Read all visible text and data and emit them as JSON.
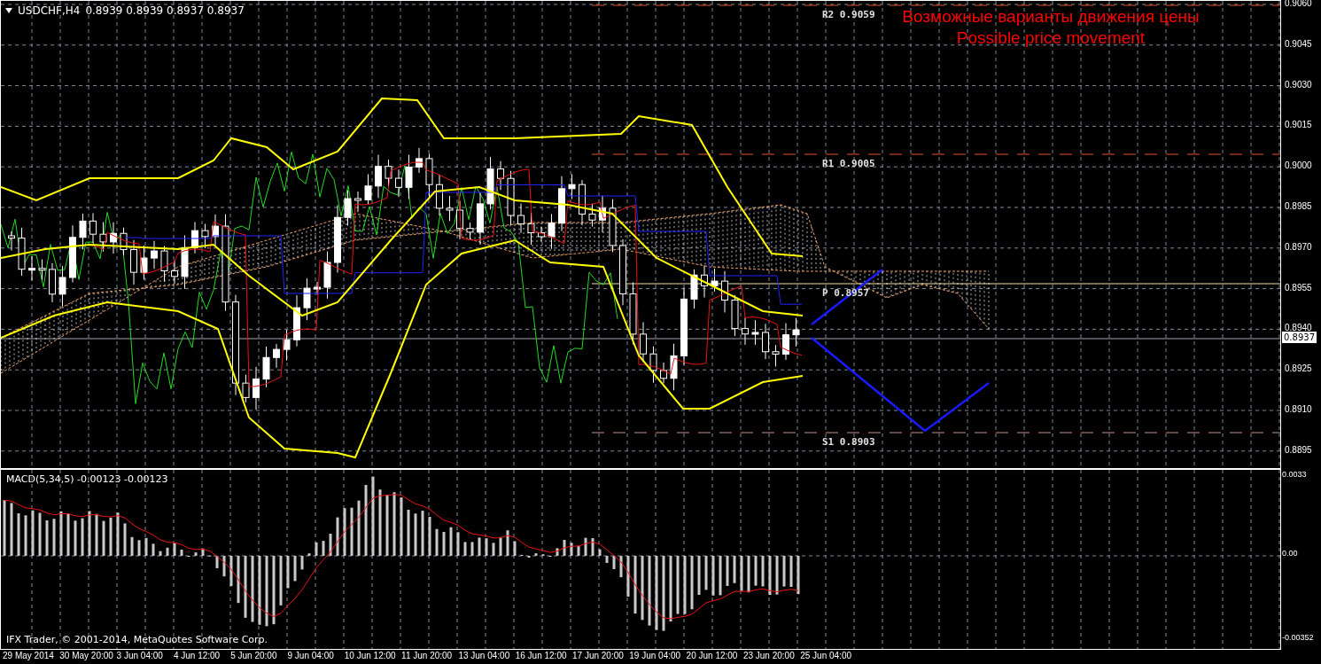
{
  "chart": {
    "title": {
      "symbol": "USDCHF,H4",
      "ohlc": "0.8939 0.8939 0.8937 0.8937"
    },
    "annotation": [
      "Возможные варианты движения цены",
      "Possible price movement"
    ],
    "levels": [
      {
        "label": "R2 0.9059",
        "kind": "resistance"
      },
      {
        "label": "R1 0.9005",
        "kind": "resistance"
      },
      {
        "label": "P 0.8957",
        "kind": "pivot"
      },
      {
        "label": "S1 0.8903",
        "kind": "support"
      }
    ],
    "price_axis": [
      "0.9060",
      "0.9045",
      "0.9030",
      "0.9015",
      "0.9000",
      "0.8985",
      "0.8970",
      "0.8955",
      "0.8940",
      "0.8925",
      "0.8910",
      "0.8895"
    ],
    "current_price": "0.8937"
  },
  "macd": {
    "label": "MACD(5,34,5) -0.00123 -0.00123",
    "axis": [
      "0.0033",
      "0.00",
      "-0.00352"
    ]
  },
  "time_axis": [
    "29 May 2014",
    "30 May 20:00",
    "3 Jun 04:00",
    "4 Jun 12:00",
    "5 Jun 20:00",
    "9 Jun 04:00",
    "10 Jun 12:00",
    "11 Jun 20:00",
    "13 Jun 04:00",
    "16 Jun 12:00",
    "17 Jun 20:00",
    "19 Jun 04:00",
    "20 Jun 12:00",
    "23 Jun 20:00",
    "25 Jun 04:00"
  ],
  "copyright": "IFX Trader, © 2001-2014, MetaQuotes Software Corp."
}
